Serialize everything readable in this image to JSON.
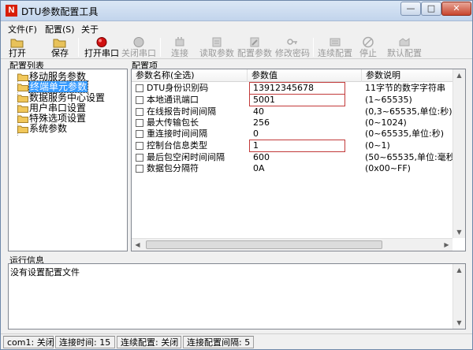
{
  "window": {
    "title": "DTU参数配置工具",
    "logo": "N",
    "min_glyph": "—",
    "max_glyph": "□",
    "close_glyph": "✕"
  },
  "menu": [
    {
      "label": "文件(F)"
    },
    {
      "label": "配置(S)"
    },
    {
      "label": "关于"
    }
  ],
  "toolbar": [
    {
      "label": "打开",
      "icon": "folder-open-icon",
      "enabled": true
    },
    {
      "label": "保存",
      "icon": "folder-save-icon",
      "enabled": true
    },
    {
      "label": "打开串口",
      "icon": "record-red-icon",
      "enabled": true
    },
    {
      "label": "关闭串口",
      "icon": "record-gray-icon",
      "enabled": false
    },
    {
      "label": "连接",
      "icon": "plug-icon",
      "enabled": false
    },
    {
      "label": "读取参数",
      "icon": "read-params-icon",
      "enabled": false
    },
    {
      "label": "配置参数",
      "icon": "write-params-icon",
      "enabled": false
    },
    {
      "label": "修改密码",
      "icon": "key-icon",
      "enabled": false
    },
    {
      "label": "连续配置",
      "icon": "batch-config-icon",
      "enabled": false
    },
    {
      "label": "停止",
      "icon": "stop-icon",
      "enabled": false
    },
    {
      "label": "默认配置",
      "icon": "default-config-icon",
      "enabled": false
    }
  ],
  "tree": {
    "section_label": "配置列表",
    "items": [
      {
        "label": "移动服务参数",
        "selected": false
      },
      {
        "label": "终端单元参数",
        "selected": true
      },
      {
        "label": "数据服务中心设置",
        "selected": false
      },
      {
        "label": "用户串口设置",
        "selected": false
      },
      {
        "label": "特殊选项设置",
        "selected": false
      },
      {
        "label": "系统参数",
        "selected": false
      }
    ]
  },
  "params": {
    "section_label": "配置项",
    "columns": [
      "参数名称(全选)",
      "参数值",
      "参数说明"
    ],
    "rows": [
      {
        "name": "DTU身份识别码",
        "value": "13912345678",
        "desc": "11字节的数字字符串",
        "boxed": true
      },
      {
        "name": "本地通讯端口",
        "value": "5001",
        "desc": "(1~65535)",
        "boxed": true
      },
      {
        "name": "在线报告时间间隔",
        "value": "40",
        "desc": "(0,3~65535,单位:秒)",
        "boxed": false
      },
      {
        "name": "最大传输包长",
        "value": "256",
        "desc": "(0~1024)",
        "boxed": false
      },
      {
        "name": "重连接时间间隔",
        "value": "0",
        "desc": "(0~65535,单位:秒)",
        "boxed": false
      },
      {
        "name": "控制台信息类型",
        "value": "1",
        "desc": "(0~1)",
        "boxed": true
      },
      {
        "name": "最后包空闲时间间隔",
        "value": "600",
        "desc": "(50~65535,单位:毫秒)",
        "boxed": false
      },
      {
        "name": "数据包分隔符",
        "value": "0A",
        "desc": "(0x00~FF)",
        "boxed": false
      }
    ]
  },
  "log": {
    "section_label": "运行信息",
    "text": "没有设置配置文件"
  },
  "status": [
    {
      "label": "com1: 关闭"
    },
    {
      "label": "连接时间: 15"
    },
    {
      "label": "连续配置: 关闭"
    },
    {
      "label": "连接配置间隔: 5"
    }
  ],
  "colors": {
    "selection": "#3399ff",
    "value_box": "#c23a3a",
    "logo": "#d81e06"
  }
}
